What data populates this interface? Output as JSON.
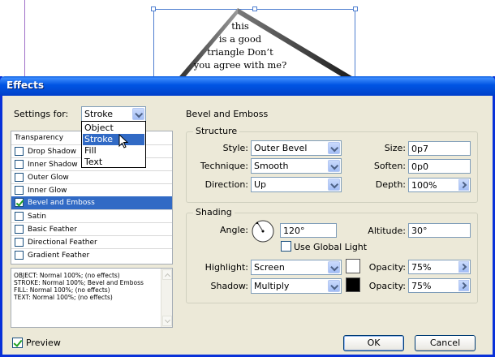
{
  "document": {
    "triangle_text": [
      "this",
      "is a good",
      "triangle Don’t",
      "you agree with me?"
    ]
  },
  "dialog": {
    "title": "Effects",
    "settings_for": {
      "label": "Settings for:",
      "value": "Stroke",
      "options": [
        "Object",
        "Stroke",
        "Fill",
        "Text"
      ],
      "highlighted": "Stroke"
    },
    "effects_header": "Transparency",
    "effects": [
      {
        "name": "Drop Shadow",
        "checked": false
      },
      {
        "name": "Inner Shadow",
        "checked": false
      },
      {
        "name": "Outer Glow",
        "checked": false
      },
      {
        "name": "Inner Glow",
        "checked": false
      },
      {
        "name": "Bevel and Emboss",
        "checked": true,
        "selected": true
      },
      {
        "name": "Satin",
        "checked": false
      },
      {
        "name": "Basic Feather",
        "checked": false
      },
      {
        "name": "Directional Feather",
        "checked": false
      },
      {
        "name": "Gradient Feather",
        "checked": false
      }
    ],
    "summary_lines": [
      "OBJECT: Normal 100%; (no effects)",
      "STROKE: Normal 100%; Bevel and Emboss",
      "FILL: Normal 100%; (no effects)",
      "TEXT: Normal 100%; (no effects)"
    ],
    "panel_title": "Bevel and Emboss",
    "structure": {
      "title": "Structure",
      "style_label": "Style:",
      "style_value": "Outer Bevel",
      "technique_label": "Technique:",
      "technique_value": "Smooth",
      "direction_label": "Direction:",
      "direction_value": "Up",
      "size_label": "Size:",
      "size_value": "0p7",
      "soften_label": "Soften:",
      "soften_value": "0p0",
      "depth_label": "Depth:",
      "depth_value": "100%"
    },
    "shading": {
      "title": "Shading",
      "angle_label": "Angle:",
      "angle_value": "120°",
      "altitude_label": "Altitude:",
      "altitude_value": "30°",
      "use_global_light_label": "Use Global Light",
      "use_global_light": false,
      "highlight_label": "Highlight:",
      "highlight_value": "Screen",
      "highlight_color": "#ffffff",
      "highlight_opacity_label": "Opacity:",
      "highlight_opacity": "75%",
      "shadow_label": "Shadow:",
      "shadow_value": "Multiply",
      "shadow_color": "#000000",
      "shadow_opacity_label": "Opacity:",
      "shadow_opacity": "75%"
    },
    "preview_label": "Preview",
    "preview_checked": true,
    "ok_label": "OK",
    "cancel_label": "Cancel"
  }
}
